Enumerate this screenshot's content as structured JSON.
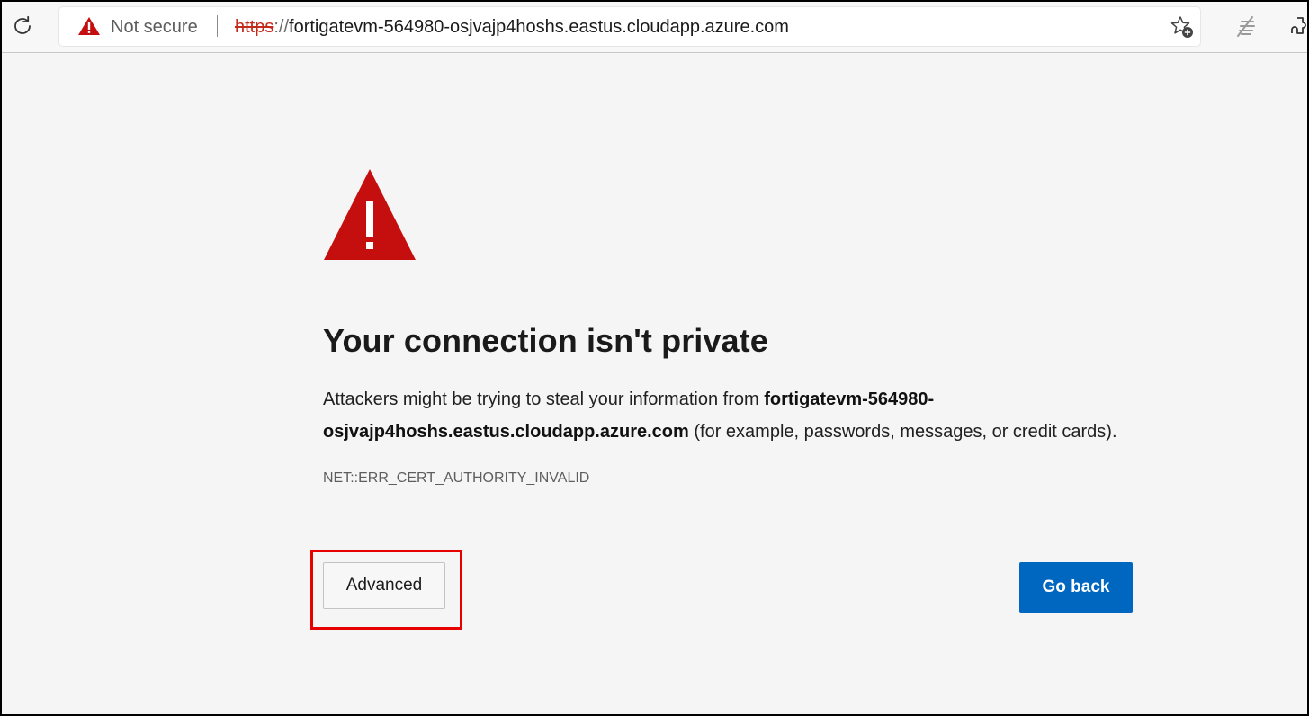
{
  "browser": {
    "security_label": "Not secure",
    "url": {
      "scheme": "https",
      "separator": "://",
      "host": "fortigatevm-564980-osjvajp4hoshs.eastus.cloudapp.azure.com"
    },
    "icons": {
      "refresh": "refresh-icon",
      "security": "warning-triangle-icon",
      "favorite": "add-favorite-icon",
      "reading": "reading-view-icon",
      "extension": "extension-icon"
    }
  },
  "error_page": {
    "icon": "warning-triangle-icon",
    "title": "Your connection isn't private",
    "description_prefix": "Attackers might be trying to steal your information from ",
    "description_host": "fortigatevm-564980-osjvajp4hoshs.eastus.cloudapp.azure.com",
    "description_suffix": " (for example, passwords, messages, or credit cards).",
    "error_code": "NET::ERR_CERT_AUTHORITY_INVALID",
    "advanced_label": "Advanced",
    "go_back_label": "Go back"
  },
  "colors": {
    "warning_red": "#c50f0f",
    "primary_button": "#0067c0",
    "highlight_box": "#e60000",
    "page_background": "#f5f5f5"
  }
}
